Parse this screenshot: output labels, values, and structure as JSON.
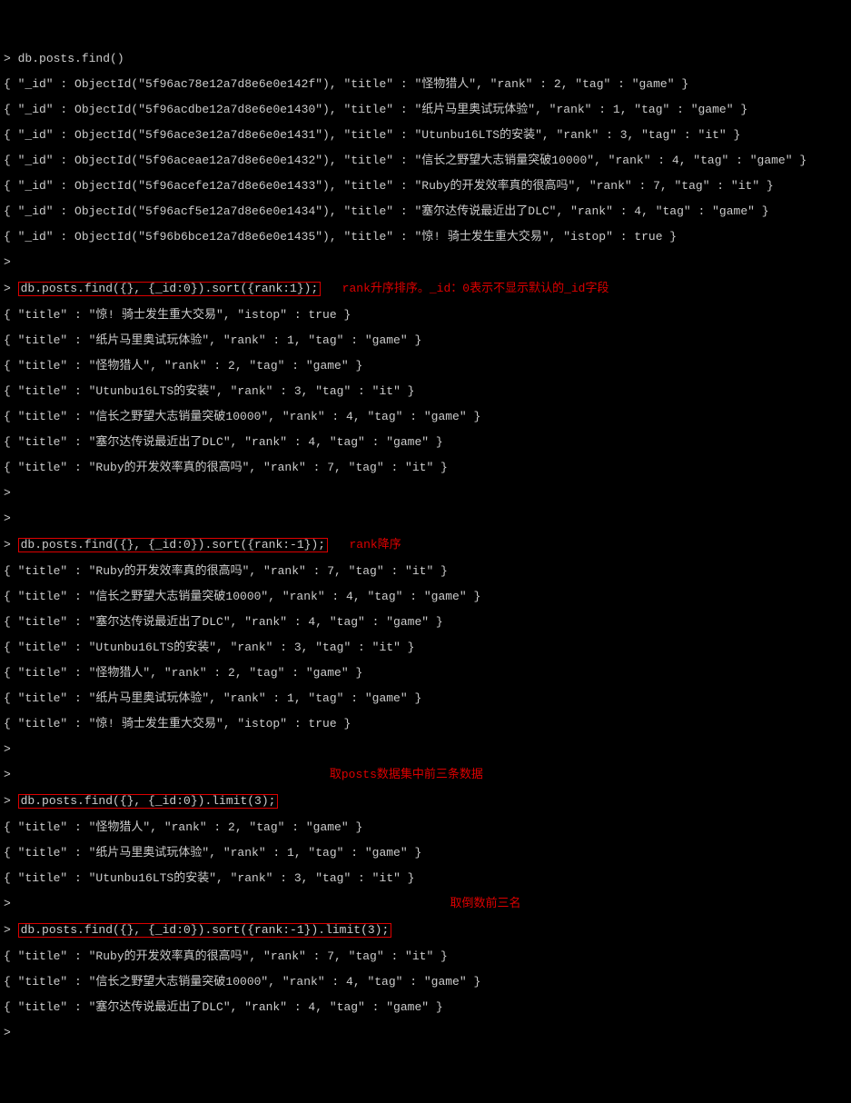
{
  "cmd1": "db.posts.find()",
  "find_all_results": [
    "{ \"_id\" : ObjectId(\"5f96ac78e12a7d8e6e0e142f\"), \"title\" : \"怪物猎人\", \"rank\" : 2, \"tag\" : \"game\" }",
    "{ \"_id\" : ObjectId(\"5f96acdbe12a7d8e6e0e1430\"), \"title\" : \"纸片马里奥试玩体验\", \"rank\" : 1, \"tag\" : \"game\" }",
    "{ \"_id\" : ObjectId(\"5f96ace3e12a7d8e6e0e1431\"), \"title\" : \"Utunbu16LTS的安装\", \"rank\" : 3, \"tag\" : \"it\" }",
    "{ \"_id\" : ObjectId(\"5f96aceae12a7d8e6e0e1432\"), \"title\" : \"信长之野望大志销量突破10000\", \"rank\" : 4, \"tag\" : \"game\" }",
    "{ \"_id\" : ObjectId(\"5f96acefe12a7d8e6e0e1433\"), \"title\" : \"Ruby的开发效率真的很高吗\", \"rank\" : 7, \"tag\" : \"it\" }",
    "{ \"_id\" : ObjectId(\"5f96acf5e12a7d8e6e0e1434\"), \"title\" : \"塞尔达传说最近出了DLC\", \"rank\" : 4, \"tag\" : \"game\" }",
    "{ \"_id\" : ObjectId(\"5f96b6bce12a7d8e6e0e1435\"), \"title\" : \"惊! 骑士发生重大交易\", \"istop\" : true }"
  ],
  "cmd2": "db.posts.find({}, {_id:0}).sort({rank:1});",
  "annot2": "rank升序排序。_id：0表示不显示默认的_id字段",
  "sort_asc_results": [
    "{ \"title\" : \"惊! 骑士发生重大交易\", \"istop\" : true }",
    "{ \"title\" : \"纸片马里奥试玩体验\", \"rank\" : 1, \"tag\" : \"game\" }",
    "{ \"title\" : \"怪物猎人\", \"rank\" : 2, \"tag\" : \"game\" }",
    "{ \"title\" : \"Utunbu16LTS的安装\", \"rank\" : 3, \"tag\" : \"it\" }",
    "{ \"title\" : \"信长之野望大志销量突破10000\", \"rank\" : 4, \"tag\" : \"game\" }",
    "{ \"title\" : \"塞尔达传说最近出了DLC\", \"rank\" : 4, \"tag\" : \"game\" }",
    "{ \"title\" : \"Ruby的开发效率真的很高吗\", \"rank\" : 7, \"tag\" : \"it\" }"
  ],
  "cmd3": "db.posts.find({}, {_id:0}).sort({rank:-1});",
  "annot3": "rank降序",
  "sort_desc_results": [
    "{ \"title\" : \"Ruby的开发效率真的很高吗\", \"rank\" : 7, \"tag\" : \"it\" }",
    "{ \"title\" : \"信长之野望大志销量突破10000\", \"rank\" : 4, \"tag\" : \"game\" }",
    "{ \"title\" : \"塞尔达传说最近出了DLC\", \"rank\" : 4, \"tag\" : \"game\" }",
    "{ \"title\" : \"Utunbu16LTS的安装\", \"rank\" : 3, \"tag\" : \"it\" }",
    "{ \"title\" : \"怪物猎人\", \"rank\" : 2, \"tag\" : \"game\" }",
    "{ \"title\" : \"纸片马里奥试玩体验\", \"rank\" : 1, \"tag\" : \"game\" }",
    "{ \"title\" : \"惊! 骑士发生重大交易\", \"istop\" : true }"
  ],
  "cmd4": "db.posts.find({}, {_id:0}).limit(3);",
  "annot4": "取posts数据集中前三条数据",
  "limit_results": [
    "{ \"title\" : \"怪物猎人\", \"rank\" : 2, \"tag\" : \"game\" }",
    "{ \"title\" : \"纸片马里奥试玩体验\", \"rank\" : 1, \"tag\" : \"game\" }",
    "{ \"title\" : \"Utunbu16LTS的安装\", \"rank\" : 3, \"tag\" : \"it\" }"
  ],
  "cmd5": "db.posts.find({}, {_id:0}).sort({rank:-1}).limit(3);",
  "annot5": "取倒数前三名",
  "sort_limit_results": [
    "{ \"title\" : \"Ruby的开发效率真的很高吗\", \"rank\" : 7, \"tag\" : \"it\" }",
    "{ \"title\" : \"信长之野望大志销量突破10000\", \"rank\" : 4, \"tag\" : \"game\" }",
    "{ \"title\" : \"塞尔达传说最近出了DLC\", \"rank\" : 4, \"tag\" : \"game\" }"
  ],
  "prompt_char": ">"
}
